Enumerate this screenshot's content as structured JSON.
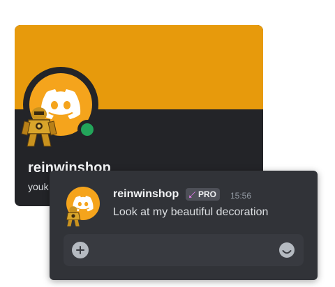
{
  "profile": {
    "display_name": "reinwinshop",
    "username": "youk",
    "banner_color": "#e79a0c",
    "avatar_color": "#f5a41c",
    "status_color": "#23a55a",
    "avatar_icon": "discord-logo-icon",
    "decoration_icon": "gold-mech-decoration-icon"
  },
  "message": {
    "author": "reinwinshop",
    "badge": "PRO",
    "badge_icon": "sword-icon",
    "timestamp": "15:56",
    "text": "Look at my beautiful decoration"
  },
  "composer": {
    "add_icon": "plus-circle-icon",
    "emoji_icon": "smiley-icon"
  }
}
